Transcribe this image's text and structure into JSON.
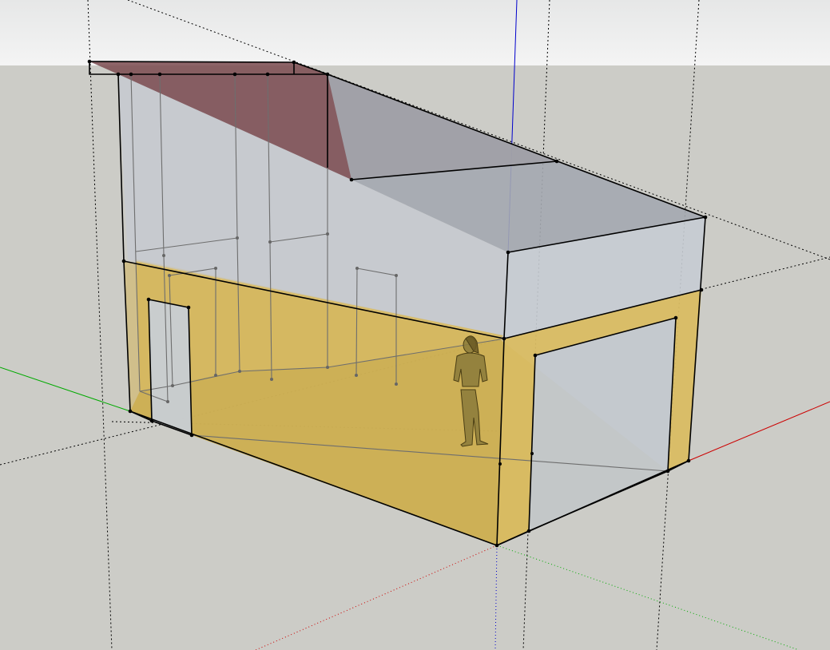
{
  "app": {
    "view": "perspective",
    "style": "x-ray"
  },
  "colors": {
    "sky_top": "#e8e9e9",
    "sky_bottom": "#f4f4f4",
    "ground": "#ccccc7",
    "roof_underside": "#7a4a4f",
    "roof_top": "#9aa0a8",
    "wall_glass": "#c9ced5",
    "floor": "#c4a84c",
    "lower_wall": "#d8b95a",
    "axis_red": "#cc0000",
    "axis_green": "#00aa00",
    "axis_blue": "#0000cc",
    "edge": "#000000"
  },
  "model": {
    "name": "lean-to shed",
    "components": [
      "roof",
      "walls",
      "floor",
      "door",
      "garage-opening",
      "scale-figure"
    ]
  },
  "icons": {
    "scale_figure": "person-figure-icon"
  }
}
